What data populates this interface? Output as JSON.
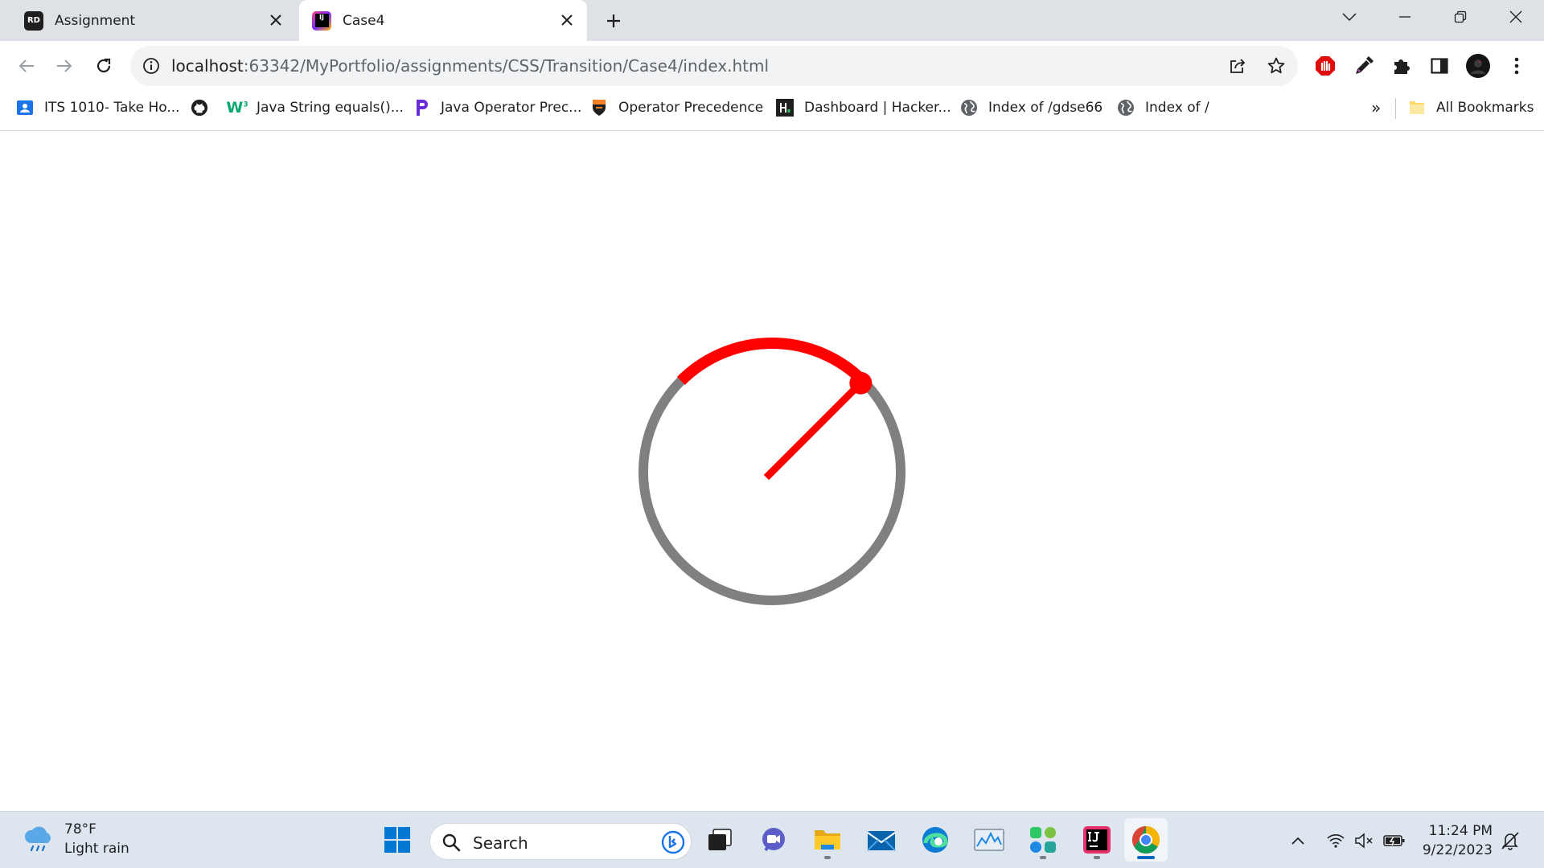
{
  "browser": {
    "tabs": [
      {
        "title": "Assignment",
        "favicon_text": "RD",
        "favicon_color": "#1f1f1f",
        "active": false
      },
      {
        "title": "Case4",
        "favicon_text": "IJ",
        "favicon_color": "#000000",
        "active": true
      }
    ],
    "address": {
      "host": "localhost",
      "path": ":63342/MyPortfolio/assignments/CSS/Transition/Case4/index.html"
    },
    "bookmarks": [
      {
        "label": "ITS 1010- Take Ho...",
        "icon": "contact-card-icon"
      },
      {
        "label": "",
        "icon": "github-icon"
      },
      {
        "label": "Java String equals()...",
        "icon": "w3schools-icon"
      },
      {
        "label": "Java Operator Prec...",
        "icon": "programiz-icon"
      },
      {
        "label": "Operator Precedence",
        "icon": "princeton-shield-icon"
      },
      {
        "label": "Dashboard | Hacker...",
        "icon": "hackerrank-icon"
      },
      {
        "label": "Index of /gdse66",
        "icon": "globe-icon"
      },
      {
        "label": "Index of /",
        "icon": "globe-icon"
      }
    ],
    "overflow_label": "»",
    "all_bookmarks": "All Bookmarks"
  },
  "gauge": {
    "needle_angle_deg": 45,
    "arc_start_deg": -45,
    "arc_end_deg": 45,
    "track_color": "#808080",
    "active_color": "#ff0000"
  },
  "taskbar": {
    "weather": {
      "temp": "78°F",
      "condition": "Light rain"
    },
    "search_label": "Search",
    "clock": {
      "time": "11:24 PM",
      "date": "9/22/2023"
    }
  },
  "colors": {
    "tabstrip": "#dee1e6",
    "accent_red": "#ff0000",
    "taskbar": "#dde5ef"
  }
}
